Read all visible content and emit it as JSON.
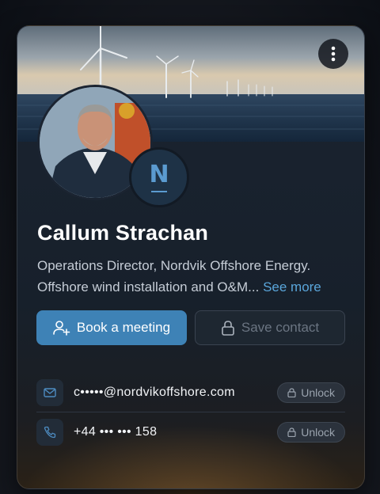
{
  "profile": {
    "name": "Callum Strachan",
    "bio_text": "Operations Director, Nordvik Offshore Energy. Offshore wind installation and O&M... ",
    "see_more": "See more",
    "logo_letter": "N"
  },
  "actions": {
    "book_label": "Book a meeting",
    "save_label": "Save contact"
  },
  "contacts": [
    {
      "type": "email",
      "icon": "mail-icon",
      "value": "c•••••@nordvikoffshore.com",
      "unlock_label": "Unlock"
    },
    {
      "type": "phone",
      "icon": "phone-icon",
      "value": "+44 ••• ••• 158",
      "unlock_label": "Unlock"
    }
  ],
  "icons": {
    "menu": "more-vertical-icon",
    "book": "user-plus-icon",
    "save": "lock-icon",
    "unlock": "lock-icon"
  },
  "colors": {
    "accent": "#3e82b6",
    "link": "#5aa6db",
    "logo": "#5b9bd0"
  }
}
